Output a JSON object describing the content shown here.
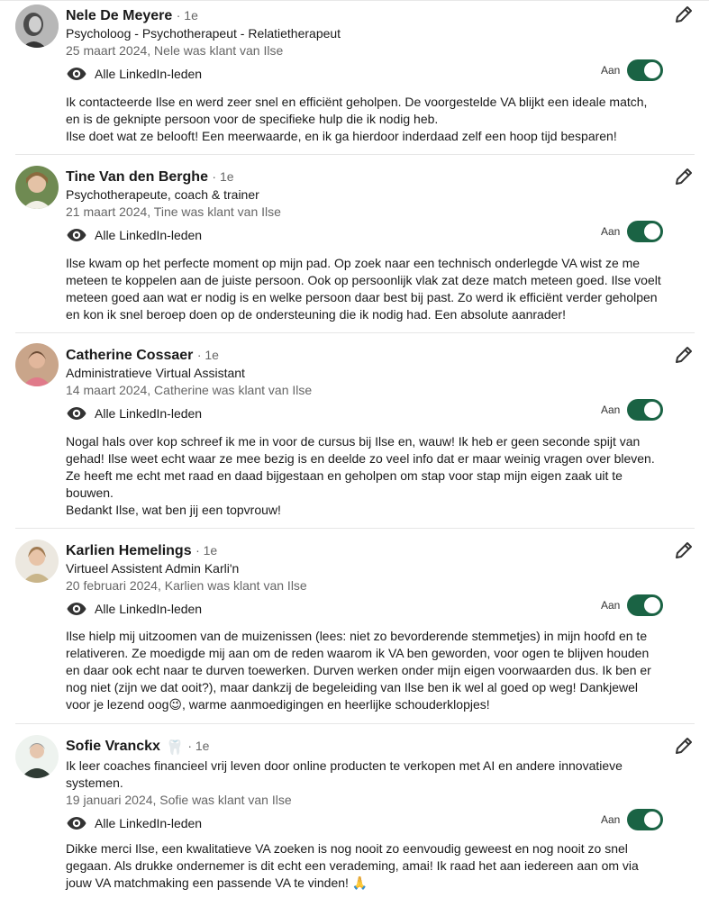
{
  "accent_color": "#1a6344",
  "recommendations": [
    {
      "name": "Nele De Meyere",
      "sticker": "",
      "degree": "· 1e",
      "headline": "Psycholoog - Psychotherapeut - Relatietherapeut",
      "date": "25 maart 2024, Nele was klant van Ilse",
      "visibility": "Alle LinkedIn-leden",
      "toggle_label": "Aan",
      "toggle_on": true,
      "avatar": "avatar-photo",
      "text": [
        "Ik contacteerde Ilse en werd zeer snel en efficiënt geholpen. De voorgestelde VA blijkt een ideale match, en is de geknipte persoon voor de specifieke hulp die ik nodig heb.",
        "Ilse doet wat ze belooft! Een meerwaarde, en ik ga hierdoor inderdaad zelf een hoop tijd besparen!"
      ]
    },
    {
      "name": "Tine Van den Berghe",
      "sticker": "",
      "degree": "· 1e",
      "headline": "Psychotherapeute, coach & trainer",
      "date": "21 maart 2024, Tine was klant van Ilse",
      "visibility": "Alle LinkedIn-leden",
      "toggle_label": "Aan",
      "toggle_on": true,
      "avatar": "avatar-photo",
      "text": [
        "Ilse kwam op het perfecte moment op mijn pad. Op zoek naar een technisch onderlegde VA wist ze me meteen te koppelen aan de juiste persoon. Ook op persoonlijk vlak zat deze match meteen goed. Ilse voelt meteen goed aan wat er nodig is en welke persoon daar best bij past. Zo werd ik efficiënt verder geholpen en kon ik snel beroep doen op de ondersteuning die ik nodig had. Een absolute aanrader!"
      ]
    },
    {
      "name": "Catherine Cossaer",
      "sticker": "",
      "degree": "· 1e",
      "headline": "Administratieve Virtual Assistant",
      "date": "14 maart 2024, Catherine was klant van Ilse",
      "visibility": "Alle LinkedIn-leden",
      "toggle_label": "Aan",
      "toggle_on": true,
      "avatar": "avatar-photo",
      "text": [
        "Nogal hals over kop schreef ik me in voor de cursus bij Ilse en, wauw! Ik heb er geen seconde spijt van gehad! Ilse weet echt waar ze mee bezig is en deelde zo veel info dat er maar weinig vragen over bleven. Ze heeft me echt met raad en daad bijgestaan en geholpen om stap voor stap mijn eigen zaak uit te bouwen.",
        "Bedankt Ilse, wat ben jij een topvrouw!"
      ]
    },
    {
      "name": "Karlien Hemelings",
      "sticker": "",
      "degree": "· 1e",
      "headline": "Virtueel Assistent Admin Karli'n",
      "date": "20 februari 2024, Karlien was klant van Ilse",
      "visibility": "Alle LinkedIn-leden",
      "toggle_label": "Aan",
      "toggle_on": true,
      "avatar": "avatar-photo",
      "text": [
        "Ilse hielp mij uitzoomen van de muizenissen (lees: niet zo bevorderende stemmetjes) in mijn hoofd en te relativeren. Ze moedigde mij aan om de reden waarom ik VA ben geworden, voor ogen te blijven houden en daar ook echt naar te durven toewerken. Durven werken onder mijn eigen voorwaarden dus. Ik ben er nog niet (zijn we dat ooit?), maar dankzij de begeleiding van Ilse ben ik wel al goed op weg! Dankjewel voor je lezend oog😉, warme aanmoedigingen en heerlijke schouderklopjes!"
      ]
    },
    {
      "name": "Sofie Vranckx",
      "sticker": "🦷",
      "degree": "· 1e",
      "headline": "Ik leer coaches financieel vrij leven door online producten te verkopen met AI en andere innovatieve systemen.",
      "date": "19 januari 2024, Sofie was klant van Ilse",
      "visibility": "Alle LinkedIn-leden",
      "toggle_label": "Aan",
      "toggle_on": true,
      "avatar": "avatar-photo",
      "text": [
        "Dikke merci Ilse, een kwalitatieve VA zoeken is nog nooit zo eenvoudig geweest en nog nooit zo snel gegaan. Als drukke ondernemer is dit echt een verademing, amai! Ik raad het aan iedereen aan om via jouw VA matchmaking een passende VA te vinden! 🙏"
      ]
    }
  ]
}
